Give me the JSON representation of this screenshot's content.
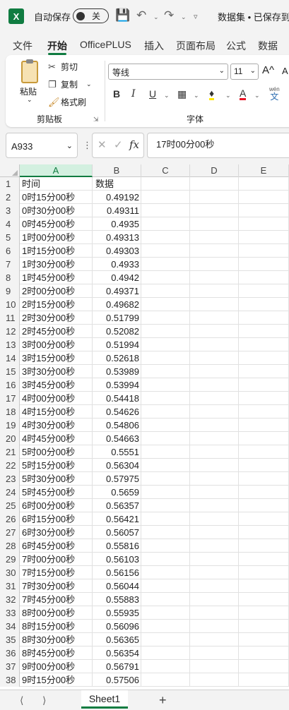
{
  "titlebar": {
    "app_icon": "X",
    "autosave_label": "自动保存",
    "autosave_state": "关",
    "document_title": "数据集 • 已保存到"
  },
  "tabs": [
    "文件",
    "开始",
    "OfficePLUS",
    "插入",
    "页面布局",
    "公式",
    "数据"
  ],
  "active_tab": "开始",
  "ribbon": {
    "clipboard": {
      "paste_label": "粘贴",
      "cut_label": "剪切",
      "copy_label": "复制",
      "format_painter_label": "格式刷",
      "group_label": "剪贴板"
    },
    "font": {
      "font_name": "等线",
      "font_size": "11",
      "grow_label": "A^",
      "shrink_label": "A",
      "bold": "B",
      "italic": "I",
      "underline": "U",
      "font_color_label": "A",
      "phonetic_top": "wén",
      "phonetic_bottom": "文",
      "group_label": "字体"
    },
    "colors": {
      "highlight": "#ffe600",
      "font_color": "#e81123",
      "accent": "#107c41"
    }
  },
  "formula_bar": {
    "name_box": "A933",
    "formula": "17时00分00秒"
  },
  "columns": [
    "A",
    "B",
    "C",
    "D",
    "E"
  ],
  "selected_column": "A",
  "rows": [
    {
      "n": "1",
      "a": "时间",
      "b": "数据"
    },
    {
      "n": "2",
      "a": "0时15分00秒",
      "b": "0.49192"
    },
    {
      "n": "3",
      "a": "0时30分00秒",
      "b": "0.49311"
    },
    {
      "n": "4",
      "a": "0时45分00秒",
      "b": "0.4935"
    },
    {
      "n": "5",
      "a": "1时00分00秒",
      "b": "0.49313"
    },
    {
      "n": "6",
      "a": "1时15分00秒",
      "b": "0.49303"
    },
    {
      "n": "7",
      "a": "1时30分00秒",
      "b": "0.4933"
    },
    {
      "n": "8",
      "a": "1时45分00秒",
      "b": "0.4942"
    },
    {
      "n": "9",
      "a": "2时00分00秒",
      "b": "0.49371"
    },
    {
      "n": "10",
      "a": "2时15分00秒",
      "b": "0.49682"
    },
    {
      "n": "11",
      "a": "2时30分00秒",
      "b": "0.51799"
    },
    {
      "n": "12",
      "a": "2时45分00秒",
      "b": "0.52082"
    },
    {
      "n": "13",
      "a": "3时00分00秒",
      "b": "0.51994"
    },
    {
      "n": "14",
      "a": "3时15分00秒",
      "b": "0.52618"
    },
    {
      "n": "15",
      "a": "3时30分00秒",
      "b": "0.53989"
    },
    {
      "n": "16",
      "a": "3时45分00秒",
      "b": "0.53994"
    },
    {
      "n": "17",
      "a": "4时00分00秒",
      "b": "0.54418"
    },
    {
      "n": "18",
      "a": "4时15分00秒",
      "b": "0.54626"
    },
    {
      "n": "19",
      "a": "4时30分00秒",
      "b": "0.54806"
    },
    {
      "n": "20",
      "a": "4时45分00秒",
      "b": "0.54663"
    },
    {
      "n": "21",
      "a": "5时00分00秒",
      "b": "0.5551"
    },
    {
      "n": "22",
      "a": "5时15分00秒",
      "b": "0.56304"
    },
    {
      "n": "23",
      "a": "5时30分00秒",
      "b": "0.57975"
    },
    {
      "n": "24",
      "a": "5时45分00秒",
      "b": "0.5659"
    },
    {
      "n": "25",
      "a": "6时00分00秒",
      "b": "0.56357"
    },
    {
      "n": "26",
      "a": "6时15分00秒",
      "b": "0.56421"
    },
    {
      "n": "27",
      "a": "6时30分00秒",
      "b": "0.56057"
    },
    {
      "n": "28",
      "a": "6时45分00秒",
      "b": "0.55816"
    },
    {
      "n": "29",
      "a": "7时00分00秒",
      "b": "0.56103"
    },
    {
      "n": "30",
      "a": "7时15分00秒",
      "b": "0.56156"
    },
    {
      "n": "31",
      "a": "7时30分00秒",
      "b": "0.56044"
    },
    {
      "n": "32",
      "a": "7时45分00秒",
      "b": "0.55883"
    },
    {
      "n": "33",
      "a": "8时00分00秒",
      "b": "0.55935"
    },
    {
      "n": "34",
      "a": "8时15分00秒",
      "b": "0.56096"
    },
    {
      "n": "35",
      "a": "8时30分00秒",
      "b": "0.56365"
    },
    {
      "n": "36",
      "a": "8时45分00秒",
      "b": "0.56354"
    },
    {
      "n": "37",
      "a": "9时00分00秒",
      "b": "0.56791"
    },
    {
      "n": "38",
      "a": "9时15分00秒",
      "b": "0.57506"
    }
  ],
  "sheets": [
    "Sheet1"
  ],
  "active_sheet": "Sheet1"
}
